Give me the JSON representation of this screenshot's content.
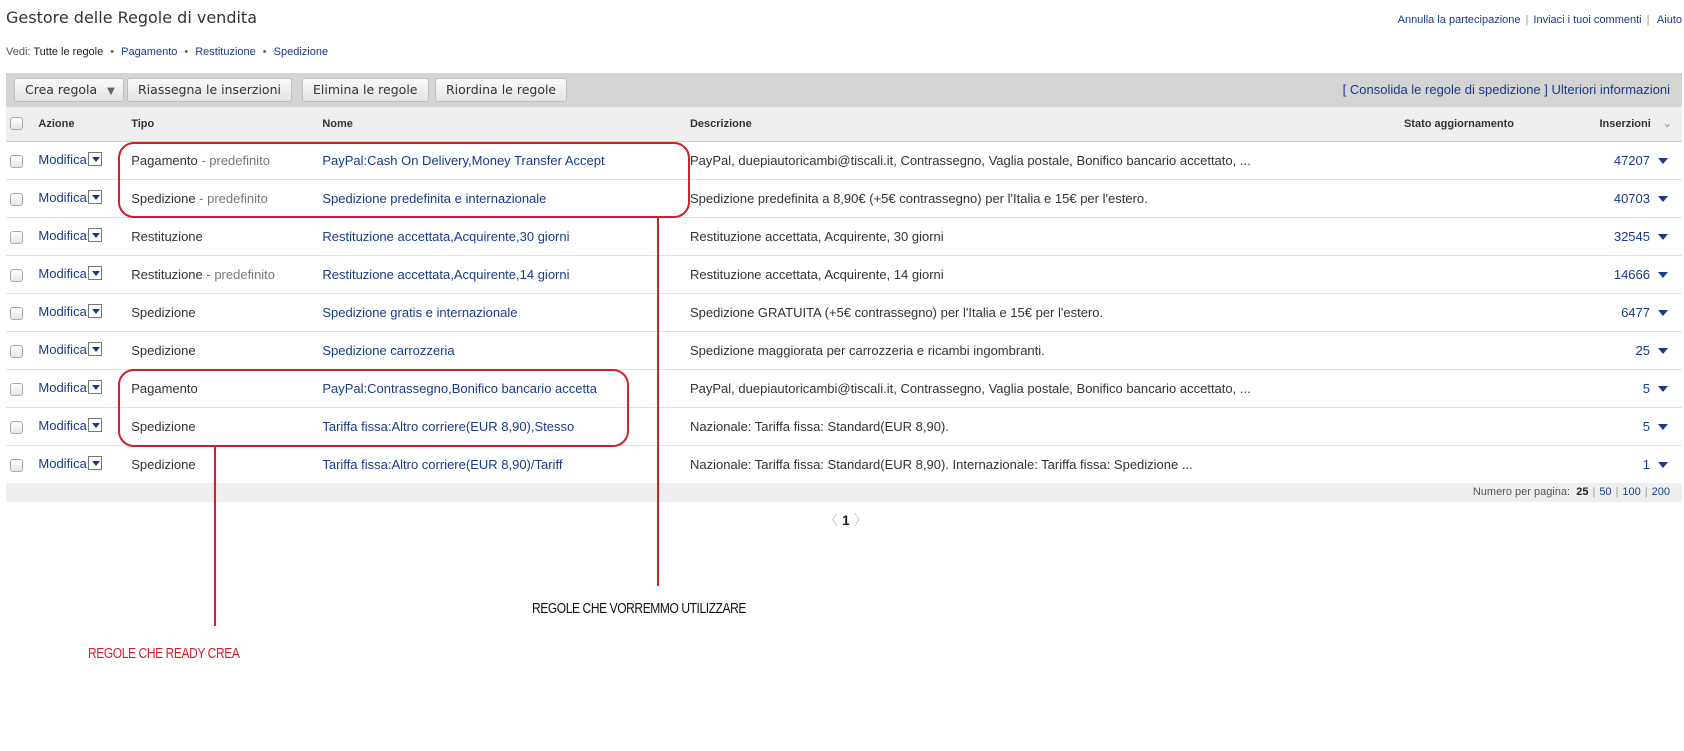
{
  "header": {
    "title": "Gestore delle Regole di vendita",
    "links": [
      "Annulla la partecipazione",
      "Inviaci i tuoi commenti",
      "Aiuto"
    ]
  },
  "filter": {
    "label": "Vedi:",
    "current": "Tutte le regole",
    "options": [
      "Pagamento",
      "Restituzione",
      "Spedizione"
    ]
  },
  "toolbar": {
    "create": "Crea regola",
    "reassign": "Riassegna le inserzioni",
    "delete": "Elimina le regole",
    "reorder": "Riordina le regole",
    "consolidate": "[ Consolida le regole di spedizione ]",
    "more_info": "Ulteriori informazioni"
  },
  "columns": {
    "action": "Azione",
    "type": "Tipo",
    "name": "Nome",
    "description": "Descrizione",
    "status": "Stato aggiornamento",
    "listings": "Inserzioni"
  },
  "rows": [
    {
      "action": "Modifica",
      "type": "Pagamento",
      "suffix": " - predefinito",
      "name": "PayPal:Cash On Delivery,Money Transfer Accept",
      "description": "PayPal, duepiautoricambi@tiscali.it, Contrassegno, Vaglia postale, Bonifico bancario accettato, ...",
      "listings": "47207"
    },
    {
      "action": "Modifica",
      "type": "Spedizione",
      "suffix": " - predefinito",
      "name": "Spedizione predefinita e internazionale",
      "description": "Spedizione predefinita a 8,90€ (+5€ contrassegno) per l'Italia e 15€ per l'estero.",
      "listings": "40703"
    },
    {
      "action": "Modifica",
      "type": "Restituzione",
      "suffix": "",
      "name": "Restituzione accettata,Acquirente,30 giorni",
      "description": "Restituzione accettata, Acquirente, 30 giorni",
      "listings": "32545"
    },
    {
      "action": "Modifica",
      "type": "Restituzione",
      "suffix": " - predefinito",
      "name": "Restituzione accettata,Acquirente,14 giorni",
      "description": "Restituzione accettata, Acquirente, 14 giorni",
      "listings": "14666"
    },
    {
      "action": "Modifica",
      "type": "Spedizione",
      "suffix": "",
      "name": "Spedizione gratis e internazionale",
      "description": "Spedizione GRATUITA (+5€ contrassegno) per l'Italia e 15€ per l'estero.",
      "listings": "6477"
    },
    {
      "action": "Modifica",
      "type": "Spedizione",
      "suffix": "",
      "name": "Spedizione carrozzeria",
      "description": "Spedizione maggiorata per carrozzeria e ricambi ingombranti.",
      "listings": "25"
    },
    {
      "action": "Modifica",
      "type": "Pagamento",
      "suffix": "",
      "name": "PayPal:Contrassegno,Bonifico bancario accetta",
      "description": "PayPal, duepiautoricambi@tiscali.it, Contrassegno, Vaglia postale, Bonifico bancario accettato, ...",
      "listings": "5"
    },
    {
      "action": "Modifica",
      "type": "Spedizione",
      "suffix": "",
      "name": "Tariffa fissa:Altro corriere(EUR 8,90),Stesso",
      "description": "Nazionale: Tariffa fissa: Standard(EUR 8,90).",
      "listings": "5"
    },
    {
      "action": "Modifica",
      "type": "Spedizione",
      "suffix": "",
      "name": "Tariffa fissa:Altro corriere(EUR 8,90)/Tariff",
      "description": "Nazionale: Tariffa fissa: Standard(EUR 8,90). Internazionale: Tariffa fissa: Spedizione ...",
      "listings": "1"
    }
  ],
  "footer": {
    "per_page_label": "Numero per pagina:",
    "per_page_current": "25",
    "per_page_options": [
      "50",
      "100",
      "200"
    ]
  },
  "pager": {
    "current": "1"
  },
  "annotations": {
    "wanted": "REGOLE CHE VORREMMO UTILIZZARE",
    "ready": "REGOLE CHE READY CREA",
    "color": "#d0202a"
  }
}
